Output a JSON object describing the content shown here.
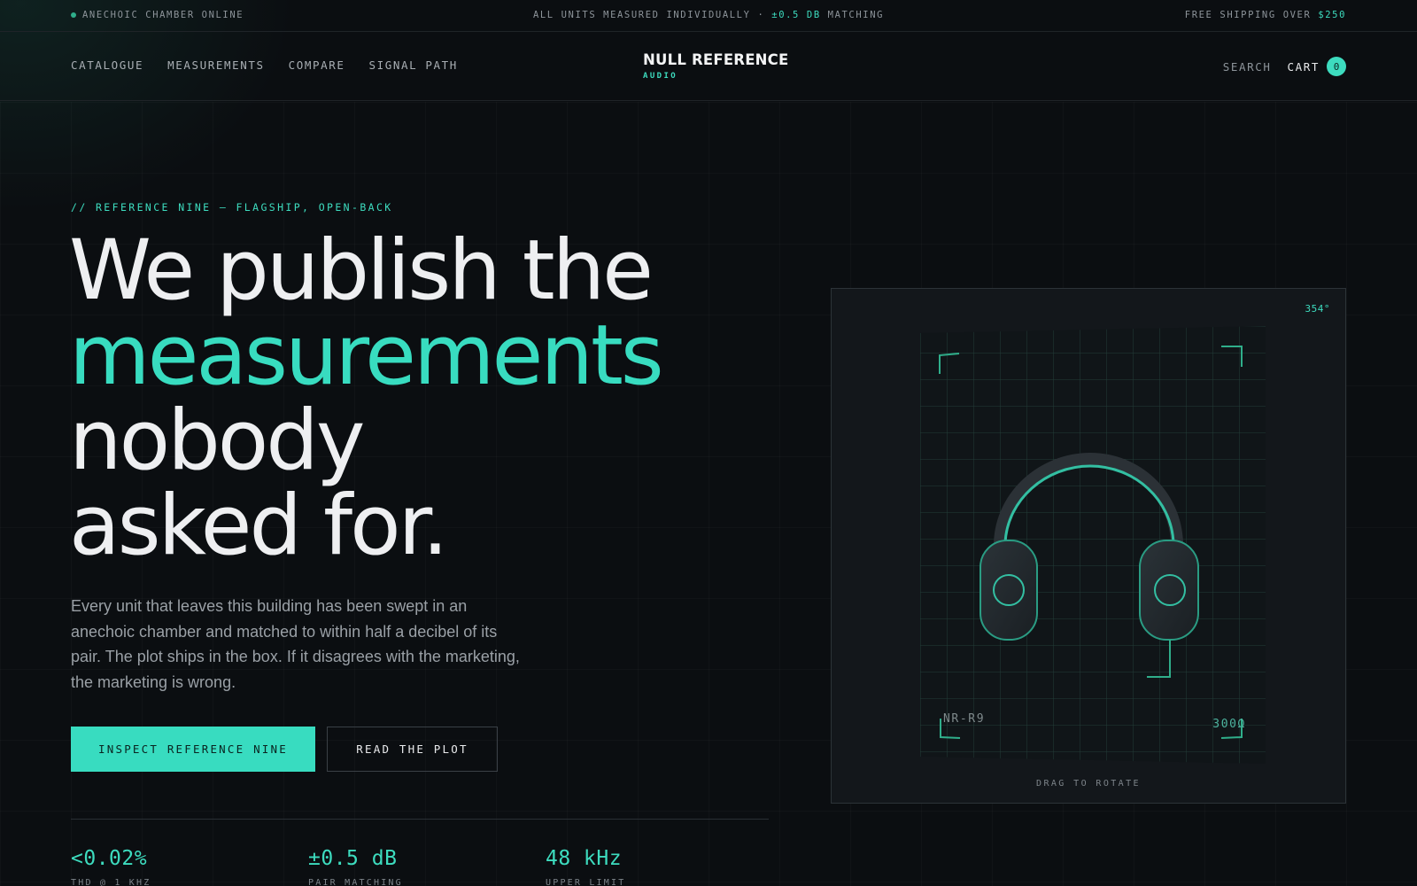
{
  "announcement": {
    "left": "ANECHOIC CHAMBER ONLINE",
    "center_prefix": "ALL UNITS MEASURED INDIVIDUALLY · ",
    "center_highlight": "±0.5 DB",
    "center_suffix": " MATCHING",
    "right_prefix": "FREE SHIPPING OVER ",
    "right_highlight": "$250"
  },
  "nav": {
    "items": [
      "CATALOGUE",
      "MEASUREMENTS",
      "COMPARE",
      "SIGNAL PATH"
    ]
  },
  "brand": {
    "name": "NULL REFERENCE",
    "sub": "AUDIO"
  },
  "header_actions": {
    "search": "SEARCH",
    "cart": "CART",
    "cart_count": "0"
  },
  "hero": {
    "eyebrow": "// REFERENCE NINE — FLAGSHIP, OPEN-BACK",
    "headline_1": "We publish the",
    "headline_2": "measurements",
    "headline_3": "nobody",
    "headline_4": "asked for.",
    "lede": "Every unit that leaves this building has been swept in an anechoic chamber and matched to within half a decibel of its pair. The plot ships in the box. If it disagrees with the marketing, the marketing is wrong.",
    "primary_cta": "INSPECT REFERENCE NINE",
    "secondary_cta": "READ THE PLOT"
  },
  "stats": [
    {
      "value": "<0.02%",
      "label": "THD @ 1 KHZ"
    },
    {
      "value": "±0.5 dB",
      "label": "PAIR MATCHING"
    },
    {
      "value": "48 kHz",
      "label": "UPPER LIMIT"
    }
  ],
  "viewer": {
    "rotation": "354°",
    "model": "NR-R9",
    "impedance": "300Ω",
    "hint": "DRAG TO ROTATE"
  },
  "colors": {
    "accent": "#3ddcbf",
    "background": "#0b0e11",
    "panel": "#13171b"
  },
  "icons": [
    "status-dot-icon",
    "headphones-render-icon"
  ]
}
